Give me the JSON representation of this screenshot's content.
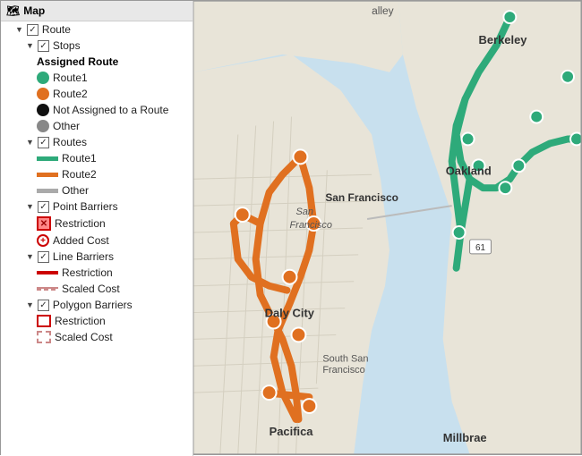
{
  "panel": {
    "header": "Map",
    "items": {
      "route_label": "Route",
      "stops_label": "Stops",
      "assigned_route_label": "Assigned Route",
      "route1_label": "Route1",
      "route2_label": "Route2",
      "not_assigned_label": "Not Assigned to a Route",
      "other_stops_label": "Other",
      "routes_label": "Routes",
      "routes_route1_label": "Route1",
      "routes_route2_label": "Route2",
      "routes_other_label": "Other",
      "point_barriers_label": "Point Barriers",
      "pb_restriction_label": "Restriction",
      "pb_added_cost_label": "Added Cost",
      "line_barriers_label": "Line Barriers",
      "lb_restriction_label": "Restriction",
      "lb_scaled_cost_label": "Scaled Cost",
      "polygon_barriers_label": "Polygon Barriers",
      "poly_restriction_label": "Restriction",
      "poly_scaled_cost_label": "Scaled Cost"
    }
  },
  "map": {
    "labels": {
      "berkeley": "Berkeley",
      "san_francisco": "San Francisco",
      "san_francisco_small": "San Francisco",
      "oakland": "Oakland",
      "daly_city": "Daly City",
      "south_san_francisco": "South San\nFrancisco",
      "pacifica": "Pacifica",
      "millbrae": "Millbrae",
      "highway_61": "61"
    }
  }
}
